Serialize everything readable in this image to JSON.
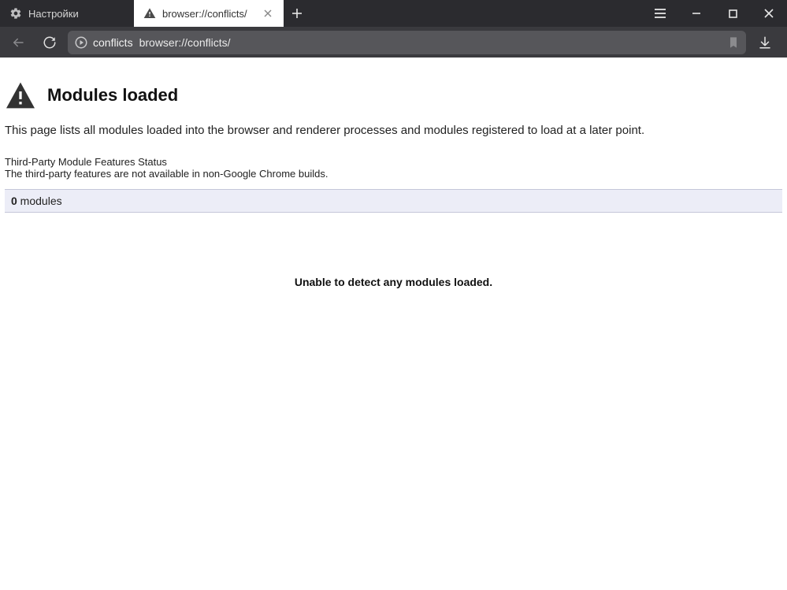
{
  "tabs": {
    "inactive": {
      "label": "Настройки"
    },
    "active": {
      "label": "browser://conflicts/"
    }
  },
  "omnibox": {
    "chip": "conflicts",
    "url": "browser://conflicts/"
  },
  "page": {
    "title": "Modules loaded",
    "description": "This page lists all modules loaded into the browser and renderer processes and modules registered to load at a later point.",
    "tp_title": "Third-Party Module Features Status",
    "tp_text": "The third-party features are not available in non-Google Chrome builds.",
    "module_count": "0",
    "module_word": " modules",
    "empty": "Unable to detect any modules loaded."
  }
}
